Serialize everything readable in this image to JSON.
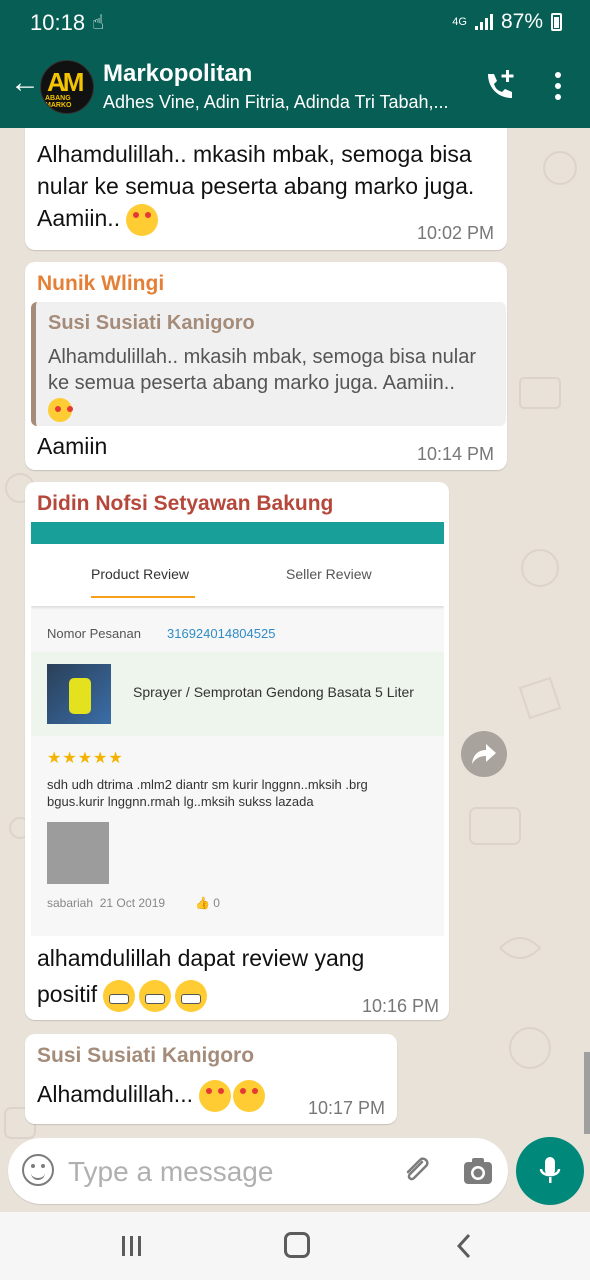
{
  "status_bar": {
    "time": "10:18",
    "network": "4G",
    "battery": "87%"
  },
  "header": {
    "title": "Markopolitan",
    "subtitle": "Adhes Vine, Adin Fitria, Adinda Tri Tabah,...",
    "avatar_text": "AM",
    "avatar_subtext": "ABANG MARKO"
  },
  "messages": [
    {
      "text": "Alhamdulillah.. mkasih mbak, semoga bisa nular ke semua peserta abang marko juga. Aamiin..",
      "time": "10:02 PM"
    },
    {
      "sender": "Nunik Wlingi",
      "sender_color": "#e57f36",
      "quote_sender": "Susi Susiati Kanigoro",
      "quote_text": "Alhamdulillah.. mkasih mbak, semoga bisa nular ke semua peserta abang marko juga. Aamiin..",
      "text": "Aamiin",
      "time": "10:14 PM"
    },
    {
      "sender": "Didin Nofsi Setyawan Bakung",
      "sender_color": "#b5483a",
      "review_image": {
        "tab_product": "Product Review",
        "tab_seller": "Seller Review",
        "order_label": "Nomor Pesanan",
        "order_number": "316924014804525",
        "product_name": "Sprayer / Semprotan Gendong Basata 5 Liter",
        "rating": 5,
        "stars": "★★★★★",
        "review_text": "sdh udh dtrima .mlm2 diantr sm kurir lnggnn..mksih .brg bgus.kurir lnggnn.rmah lg..mksih sukss lazada",
        "reviewer": "sabariah",
        "date": "21 Oct 2019",
        "likes": "0"
      },
      "text_line1": "alhamdulillah dapat review yang",
      "text_line2": "positif",
      "time": "10:16 PM"
    },
    {
      "sender": "Susi Susiati Kanigoro",
      "sender_color": "#a58c7a",
      "text": "Alhamdulillah...",
      "time": "10:17 PM"
    }
  ],
  "input": {
    "placeholder": "Type a message"
  },
  "colors": {
    "header": "#075e54",
    "accent": "#00897b",
    "bubble": "#ffffff",
    "chat_bg": "#e9e2d9"
  }
}
